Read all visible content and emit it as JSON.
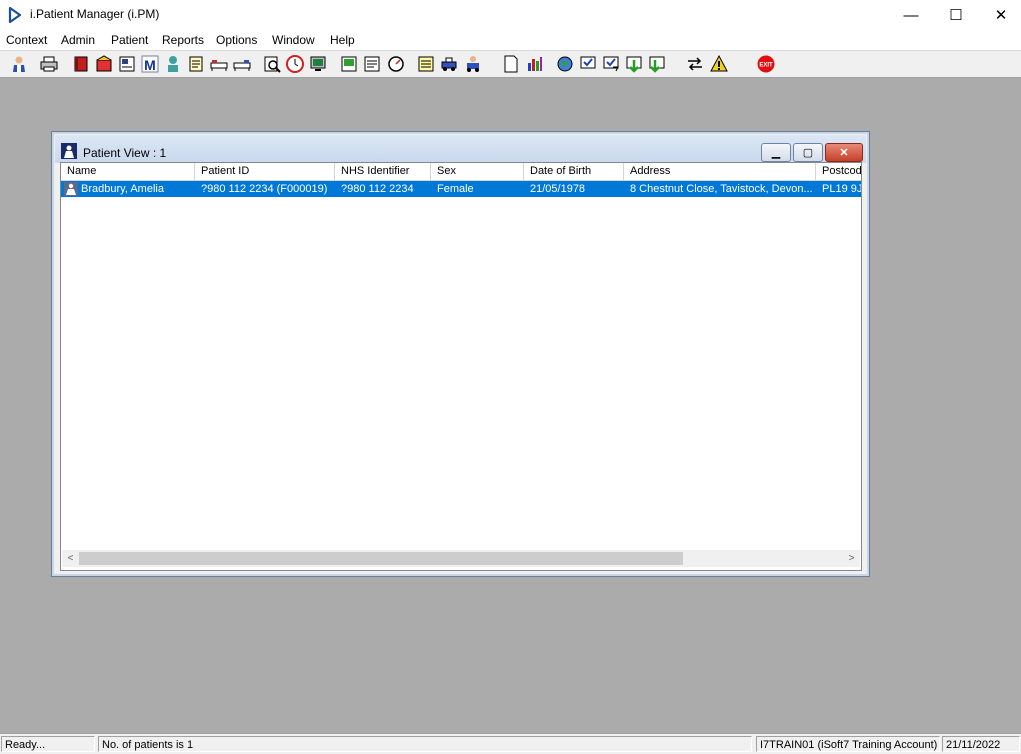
{
  "app": {
    "title": "i.Patient Manager (i.PM)"
  },
  "window_controls": {
    "minimize": "—",
    "maximize": "☐",
    "close": "✕"
  },
  "menu": [
    "Context",
    "Admin",
    "Patient",
    "Reports",
    "Options",
    "Window",
    "Help"
  ],
  "toolbar": {
    "icons": [
      "patient-search-icon",
      "print-icon",
      "book-icon",
      "referral-icon",
      "outpatient-icon",
      "mail-icon",
      "person-icon",
      "notes-icon",
      "ward-icon",
      "bed-icon",
      "find-icon",
      "clock-icon",
      "monitor-icon",
      "document-icon",
      "letter-icon",
      "timer-icon",
      "list-icon",
      "transport-icon",
      "ambulance-icon",
      "page-icon",
      "chart-icon",
      "globe-icon",
      "checkin-icon",
      "checkout-icon",
      "transfer-icon",
      "discharge-icon",
      "swap-icon",
      "warning-icon",
      "exit-icon"
    ],
    "exit_label": "EXIT"
  },
  "patient_view": {
    "title": "Patient View : 1",
    "columns": [
      "Name",
      "Patient ID",
      "NHS Identifier",
      "Sex",
      "Date of Birth",
      "Address",
      "Postcod"
    ],
    "rows": [
      {
        "name": "Bradbury, Amelia",
        "patient_id": "?980 112 2234 (F000019)",
        "nhs_identifier": "?980 112 2234",
        "sex": "Female",
        "dob": "21/05/1978",
        "address": "8 Chestnut Close, Tavistock, Devon...",
        "postcode": "PL19 9J"
      }
    ],
    "scroll_left": "<",
    "scroll_right": ">"
  },
  "status": {
    "ready": "Ready...",
    "patient_count": "No. of patients is 1",
    "account": "I7TRAIN01 (iSoft7 Training Account)",
    "date": "21/11/2022"
  }
}
